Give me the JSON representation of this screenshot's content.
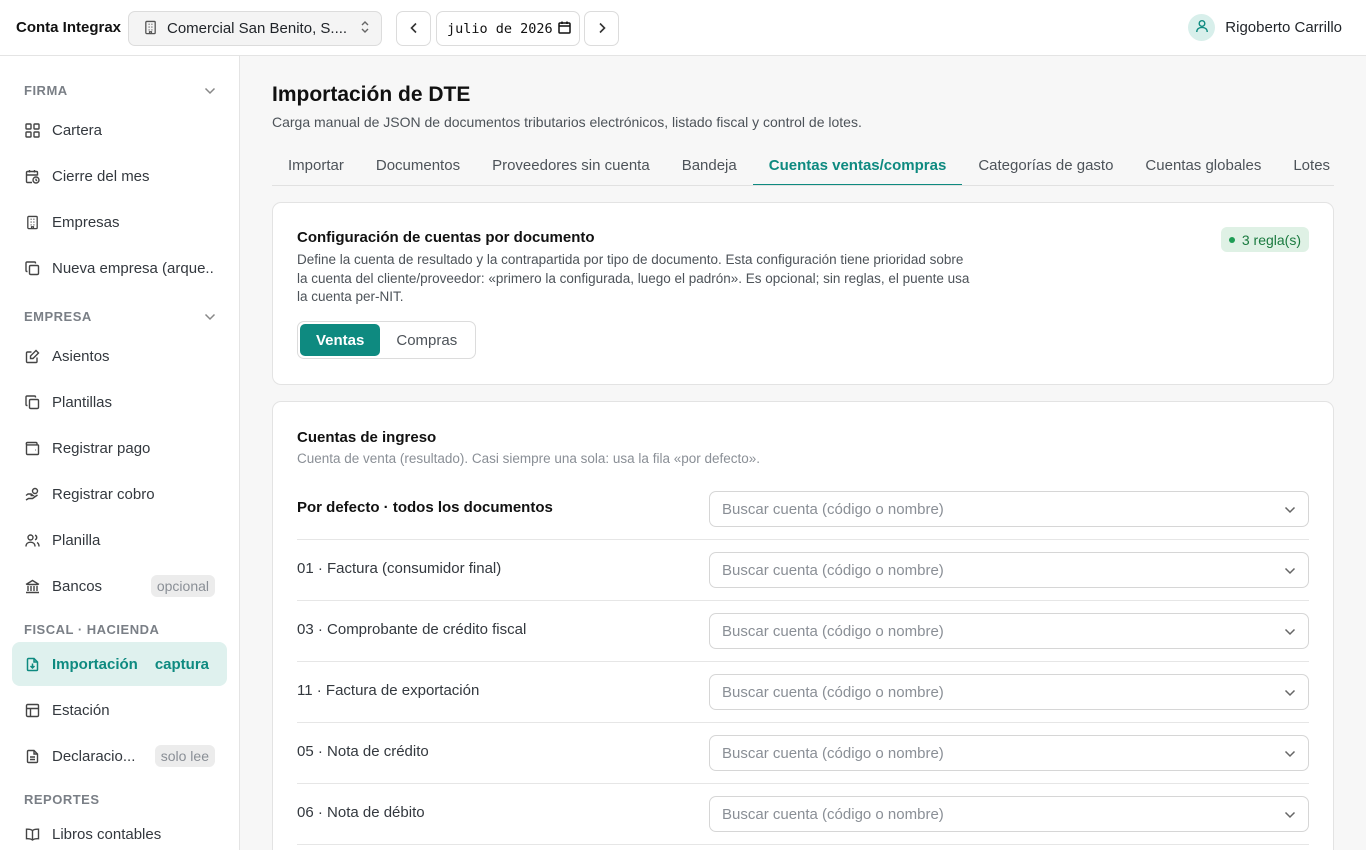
{
  "header": {
    "brand": "Conta Integrax",
    "company": "Comercial San Benito, S....",
    "period": "julio de 2026",
    "user": "Rigoberto Carrillo"
  },
  "sidebar": {
    "sections": [
      {
        "title": "FIRMA"
      },
      {
        "title": "EMPRESA"
      },
      {
        "title": "FISCAL · HACIENDA"
      },
      {
        "title": "REPORTES"
      }
    ],
    "items": [
      {
        "label": "Cartera",
        "icon": "grid-icon"
      },
      {
        "label": "Cierre del mes",
        "icon": "calendar-clock-icon"
      },
      {
        "label": "Empresas",
        "icon": "building-icon"
      },
      {
        "label": "Nueva empresa (arque...",
        "icon": "copy-icon"
      },
      {
        "label": "Asientos",
        "icon": "edit-doc-icon"
      },
      {
        "label": "Plantillas",
        "icon": "copy-icon"
      },
      {
        "label": "Registrar pago",
        "icon": "wallet-icon"
      },
      {
        "label": "Registrar cobro",
        "icon": "hand-coins-icon"
      },
      {
        "label": "Planilla",
        "icon": "users-icon"
      },
      {
        "label": "Bancos",
        "icon": "bank-icon",
        "tag": "opcional"
      },
      {
        "label": "Importación",
        "icon": "file-import-icon",
        "tag": "captura"
      },
      {
        "label": "Estación",
        "icon": "table-icon"
      },
      {
        "label": "Declaracio...",
        "icon": "file-text-icon",
        "tag": "solo lee"
      },
      {
        "label": "Libros contables",
        "icon": "book-icon"
      }
    ]
  },
  "page": {
    "title": "Importación de DTE",
    "subtitle": "Carga manual de JSON de documentos tributarios electrónicos, listado fiscal y control de lotes.",
    "tabs": [
      "Importar",
      "Documentos",
      "Proveedores sin cuenta",
      "Bandeja",
      "Cuentas ventas/compras",
      "Categorías de gasto",
      "Cuentas globales",
      "Lotes"
    ],
    "active_tab": "Cuentas ventas/compras"
  },
  "config_card": {
    "title": "Configuración de cuentas por documento",
    "description": "Define la cuenta de resultado y la contrapartida por tipo de documento. Esta configuración tiene prioridad sobre la cuenta del cliente/proveedor: «primero la configurada, luego el padrón». Es opcional; sin reglas, el puente usa la cuenta per-NIT.",
    "badge": "3 regla(s)",
    "segments": [
      "Ventas",
      "Compras"
    ],
    "active_segment": "Ventas"
  },
  "income_card": {
    "title": "Cuentas de ingreso",
    "subtitle": "Cuenta de venta (resultado). Casi siempre una sola: usa la fila «por defecto».",
    "placeholder": "Buscar cuenta (código o nombre)",
    "rows": [
      {
        "label": "Por defecto · todos los documentos"
      },
      {
        "label": "01 · Factura (consumidor final)"
      },
      {
        "label": "03 · Comprobante de crédito fiscal"
      },
      {
        "label": "11 · Factura de exportación"
      },
      {
        "label": "05 · Nota de crédito"
      },
      {
        "label": "06 · Nota de débito"
      }
    ]
  },
  "colors": {
    "accent": "#0e8a80",
    "accent_bg": "#dff1ee",
    "badge_bg": "#dff1e5",
    "badge_text": "#1a7a3f"
  }
}
